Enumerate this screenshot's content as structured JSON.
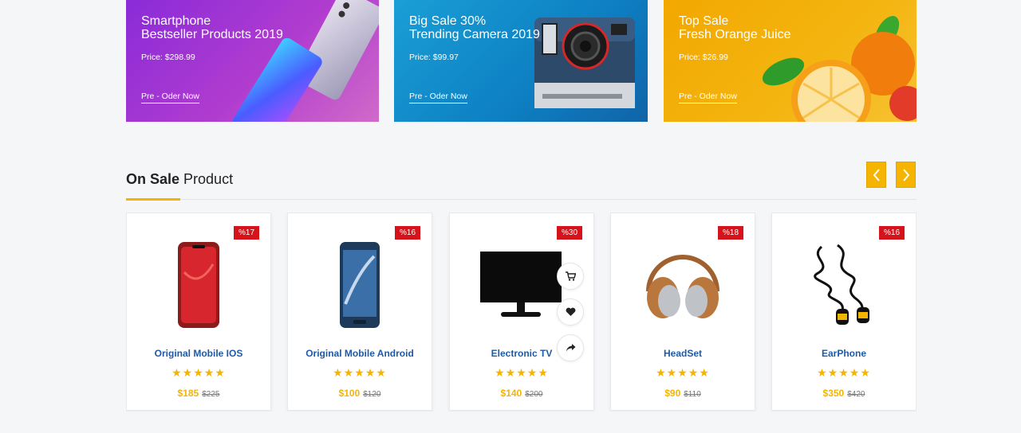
{
  "banners": [
    {
      "line1": "Smartphone",
      "line2": "Bestseller Products 2019",
      "price": "Price: $298.99",
      "cta": "Pre - Oder Now"
    },
    {
      "line1": "Big Sale 30%",
      "line2": "Trending Camera 2019",
      "price": "Price: $99.97",
      "cta": "Pre - Oder Now"
    },
    {
      "line1": "Top Sale",
      "line2": "Fresh Orange Juice",
      "price": "Price: $26.99",
      "cta": "Pre - Oder Now"
    }
  ],
  "section": {
    "title_bold": "On Sale",
    "title_rest": " Product"
  },
  "products": [
    {
      "name": "Original Mobile IOS",
      "badge": "%17",
      "stars": "★★★★★",
      "price": "$185",
      "old_price": "$225"
    },
    {
      "name": "Original Mobile Android",
      "badge": "%16",
      "stars": "★★★★★",
      "price": "$100",
      "old_price": "$120"
    },
    {
      "name": "Electronic TV",
      "badge": "%30",
      "stars": "★★★★★",
      "price": "$140",
      "old_price": "$200"
    },
    {
      "name": "HeadSet",
      "badge": "%18",
      "stars": "★★★★★",
      "price": "$90",
      "old_price": "$110"
    },
    {
      "name": "EarPhone",
      "badge": "%16",
      "stars": "★★★★★",
      "price": "$350",
      "old_price": "$420"
    }
  ],
  "colors": {
    "accent": "#f4b400",
    "badge": "#d4141a",
    "link": "#1e5aa8"
  },
  "icons": {
    "prev": "chevron-left-icon",
    "next": "chevron-right-icon",
    "cart": "cart-icon",
    "wishlist": "heart-icon",
    "share": "share-icon"
  }
}
